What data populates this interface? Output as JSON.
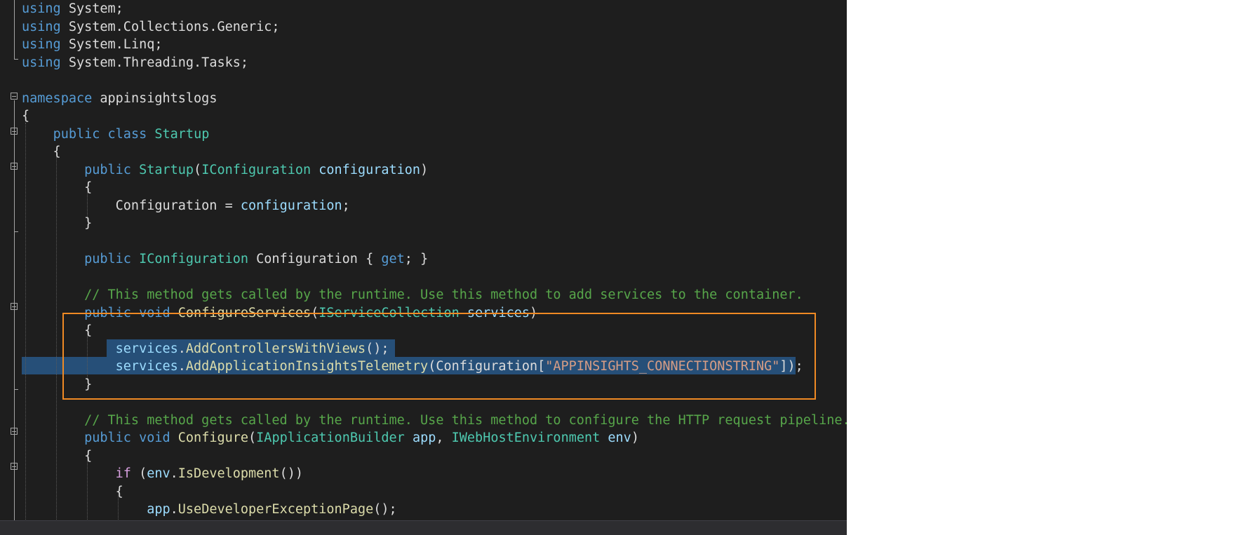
{
  "editor": {
    "lines": [
      {
        "tokens": [
          {
            "t": "using",
            "c": "kw"
          },
          {
            "t": " System;",
            "c": "pl"
          }
        ]
      },
      {
        "tokens": [
          {
            "t": "using",
            "c": "kw"
          },
          {
            "t": " System.Collections.Generic;",
            "c": "pl"
          }
        ]
      },
      {
        "tokens": [
          {
            "t": "using",
            "c": "kw"
          },
          {
            "t": " System.Linq;",
            "c": "pl"
          }
        ]
      },
      {
        "tokens": [
          {
            "t": "using",
            "c": "kw"
          },
          {
            "t": " System.Threading.Tasks;",
            "c": "pl"
          }
        ]
      },
      {
        "tokens": []
      },
      {
        "tokens": [
          {
            "t": "namespace",
            "c": "kw"
          },
          {
            "t": " appinsightslogs",
            "c": "pl"
          }
        ]
      },
      {
        "tokens": [
          {
            "t": "{",
            "c": "pl"
          }
        ]
      },
      {
        "tokens": [
          {
            "t": "    ",
            "c": "pl"
          },
          {
            "t": "public",
            "c": "kw"
          },
          {
            "t": " ",
            "c": "pl"
          },
          {
            "t": "class",
            "c": "kw"
          },
          {
            "t": " ",
            "c": "pl"
          },
          {
            "t": "Startup",
            "c": "ty"
          }
        ]
      },
      {
        "tokens": [
          {
            "t": "    {",
            "c": "pl"
          }
        ]
      },
      {
        "tokens": [
          {
            "t": "        ",
            "c": "pl"
          },
          {
            "t": "public",
            "c": "kw"
          },
          {
            "t": " ",
            "c": "pl"
          },
          {
            "t": "Startup",
            "c": "ty"
          },
          {
            "t": "(",
            "c": "pl"
          },
          {
            "t": "IConfiguration",
            "c": "ty"
          },
          {
            "t": " ",
            "c": "pl"
          },
          {
            "t": "configuration",
            "c": "pa"
          },
          {
            "t": ")",
            "c": "pl"
          }
        ]
      },
      {
        "tokens": [
          {
            "t": "        {",
            "c": "pl"
          }
        ]
      },
      {
        "tokens": [
          {
            "t": "            Configuration = ",
            "c": "pl"
          },
          {
            "t": "configuration",
            "c": "pa"
          },
          {
            "t": ";",
            "c": "pl"
          }
        ]
      },
      {
        "tokens": [
          {
            "t": "        }",
            "c": "pl"
          }
        ]
      },
      {
        "tokens": []
      },
      {
        "tokens": [
          {
            "t": "        ",
            "c": "pl"
          },
          {
            "t": "public",
            "c": "kw"
          },
          {
            "t": " ",
            "c": "pl"
          },
          {
            "t": "IConfiguration",
            "c": "ty"
          },
          {
            "t": " Configuration { ",
            "c": "pl"
          },
          {
            "t": "get",
            "c": "kw"
          },
          {
            "t": "; }",
            "c": "pl"
          }
        ]
      },
      {
        "tokens": []
      },
      {
        "tokens": [
          {
            "t": "        ",
            "c": "pl"
          },
          {
            "t": "// This method gets called by the runtime. Use this method to add services to the container.",
            "c": "cm"
          }
        ]
      },
      {
        "tokens": [
          {
            "t": "        ",
            "c": "pl"
          },
          {
            "t": "public",
            "c": "kw"
          },
          {
            "t": " ",
            "c": "pl"
          },
          {
            "t": "void",
            "c": "kw"
          },
          {
            "t": " ",
            "c": "pl"
          },
          {
            "t": "ConfigureServices",
            "c": "fn"
          },
          {
            "t": "(",
            "c": "pl"
          },
          {
            "t": "IServiceCollection",
            "c": "ty"
          },
          {
            "t": " ",
            "c": "pl"
          },
          {
            "t": "services",
            "c": "pa"
          },
          {
            "t": ")",
            "c": "pl"
          }
        ]
      },
      {
        "tokens": [
          {
            "t": "        {",
            "c": "pl"
          }
        ]
      },
      {
        "tokens": [
          {
            "t": "            ",
            "c": "pl"
          },
          {
            "t": "services",
            "c": "pa"
          },
          {
            "t": ".",
            "c": "pl"
          },
          {
            "t": "AddControllersWithViews",
            "c": "fn"
          },
          {
            "t": "();",
            "c": "pl"
          }
        ]
      },
      {
        "tokens": [
          {
            "t": "            ",
            "c": "pl"
          },
          {
            "t": "services",
            "c": "pa"
          },
          {
            "t": ".",
            "c": "pl"
          },
          {
            "t": "AddApplicationInsightsTelemetry",
            "c": "fn"
          },
          {
            "t": "(Configuration[",
            "c": "pl"
          },
          {
            "t": "\"APPINSIGHTS_CONNECTIONSTRING\"",
            "c": "st"
          },
          {
            "t": "]);",
            "c": "pl"
          }
        ]
      },
      {
        "tokens": [
          {
            "t": "        }",
            "c": "pl"
          }
        ]
      },
      {
        "tokens": []
      },
      {
        "tokens": [
          {
            "t": "        ",
            "c": "pl"
          },
          {
            "t": "// This method gets called by the runtime. Use this method to configure the HTTP request pipeline.",
            "c": "cm"
          }
        ]
      },
      {
        "tokens": [
          {
            "t": "        ",
            "c": "pl"
          },
          {
            "t": "public",
            "c": "kw"
          },
          {
            "t": " ",
            "c": "pl"
          },
          {
            "t": "void",
            "c": "kw"
          },
          {
            "t": " ",
            "c": "pl"
          },
          {
            "t": "Configure",
            "c": "fn"
          },
          {
            "t": "(",
            "c": "pl"
          },
          {
            "t": "IApplicationBuilder",
            "c": "ty"
          },
          {
            "t": " ",
            "c": "pl"
          },
          {
            "t": "app",
            "c": "pa"
          },
          {
            "t": ", ",
            "c": "pl"
          },
          {
            "t": "IWebHostEnvironment",
            "c": "ty"
          },
          {
            "t": " ",
            "c": "pl"
          },
          {
            "t": "env",
            "c": "pa"
          },
          {
            "t": ")",
            "c": "pl"
          }
        ]
      },
      {
        "tokens": [
          {
            "t": "        {",
            "c": "pl"
          }
        ]
      },
      {
        "tokens": [
          {
            "t": "            ",
            "c": "pl"
          },
          {
            "t": "if",
            "c": "ct"
          },
          {
            "t": " (",
            "c": "pl"
          },
          {
            "t": "env",
            "c": "pa"
          },
          {
            "t": ".",
            "c": "pl"
          },
          {
            "t": "IsDevelopment",
            "c": "fn"
          },
          {
            "t": "())",
            "c": "pl"
          }
        ]
      },
      {
        "tokens": [
          {
            "t": "            {",
            "c": "pl"
          }
        ]
      },
      {
        "tokens": [
          {
            "t": "                ",
            "c": "pl"
          },
          {
            "t": "app",
            "c": "pa"
          },
          {
            "t": ".",
            "c": "pl"
          },
          {
            "t": "UseDeveloperExceptionPage",
            "c": "fn"
          },
          {
            "t": "();",
            "c": "pl"
          }
        ]
      }
    ],
    "colors": {
      "background": "#1e1e1e",
      "keyword": "#569cd6",
      "type": "#4ec9b0",
      "comment": "#57a64a",
      "parameter": "#9cdcfe",
      "string": "#d69d85",
      "control": "#d8a0df",
      "method": "#dcdcaa",
      "plain": "#dcdcdc",
      "selection": "#264f78",
      "highlight_box": "#f08a24"
    }
  }
}
